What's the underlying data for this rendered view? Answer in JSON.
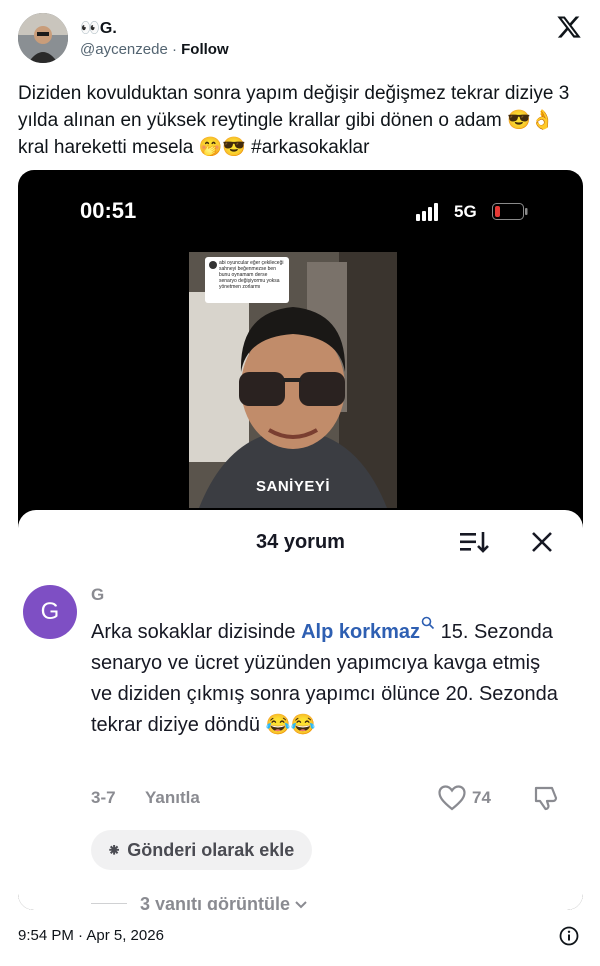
{
  "author": {
    "name": "👀G.",
    "handle": "@aycenzede",
    "separator": " · ",
    "follow_label": "Follow"
  },
  "tweet": {
    "text": "Diziden kovulduktan sonra yapım değişir değişmez   tekrar diziye 3 yılda alınan en yüksek reytingle krallar gibi dönen o adam 😎👌kral hareketti mesela 🤭😎 ",
    "hashtag": "#arkasokaklar"
  },
  "media": {
    "status_time": "00:51",
    "network": "5G",
    "sticker_text": "abi oyuncular eğer çekileceği sahneyi beğenmezse ben bunu oynamam derse senaryo değişiyormu yoksa yönetmen zorlarmı",
    "caption": "SANİYEYİ",
    "comments": {
      "title": "34 yorum",
      "comment": {
        "avatar_letter": "G",
        "username": "G",
        "text_before": "Arka sokaklar dizisinde ",
        "link": "Alp korkmaz",
        "text_after": " 15. Sezonda senaryo ve ücret yüzünden yapımcıya kavga etmiş ve diziden çıkmış sonra yapımcı ölünce 20. Sezonda tekrar diziye döndü 😂😂",
        "date": "3-7",
        "reply_label": "Yanıtla",
        "likes": "74"
      },
      "post_button": "Gönderi olarak ekle",
      "view_replies": "3 yanıtı görüntüle"
    }
  },
  "footer": {
    "timestamp": "9:54 PM · Apr 5, 2026"
  },
  "colors": {
    "link": "#2e5fb2",
    "avatar_purple": "#7e4fc4",
    "battery_red": "#e53935"
  }
}
